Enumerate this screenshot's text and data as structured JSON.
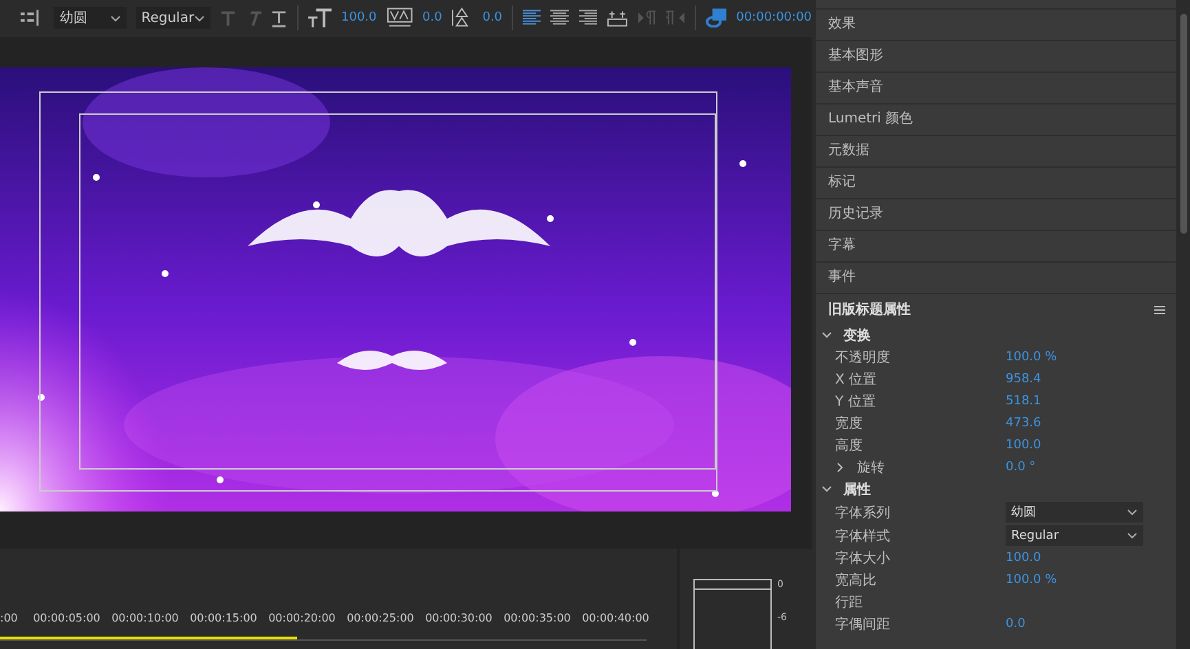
{
  "toolbar": {
    "font_family": "幼圆",
    "font_style": "Regular",
    "font_size": "100.0",
    "kerning": "0.0",
    "leading": "0.0",
    "alignment": [
      {
        "selected": true
      },
      {
        "selected": false
      },
      {
        "selected": false
      }
    ],
    "timecode": "00:00:00:00"
  },
  "panels": [
    "效果",
    "基本图形",
    "基本声音",
    "Lumetri 颜色",
    "元数据",
    "标记",
    "历史记录",
    "字幕",
    "事件"
  ],
  "properties": {
    "title": "旧版标题属性",
    "sections": [
      {
        "label": "变换",
        "expanded": true,
        "rows": [
          {
            "kind": "value",
            "label": "不透明度",
            "value": "100.0 %"
          },
          {
            "kind": "value",
            "label": "X 位置",
            "value": "958.4"
          },
          {
            "kind": "value",
            "label": "Y 位置",
            "value": "518.1"
          },
          {
            "kind": "value",
            "label": "宽度",
            "value": "473.6"
          },
          {
            "kind": "value",
            "label": "高度",
            "value": "100.0"
          },
          {
            "kind": "group",
            "label": "旋转",
            "expanded": false,
            "value": "0.0 °"
          }
        ]
      },
      {
        "label": "属性",
        "expanded": true,
        "rows": [
          {
            "kind": "dropdown",
            "label": "字体系列",
            "value": "幼圆"
          },
          {
            "kind": "dropdown",
            "label": "字体样式",
            "value": "Regular"
          },
          {
            "kind": "value",
            "label": "字体大小",
            "value": "100.0"
          },
          {
            "kind": "value",
            "label": "宽高比",
            "value": "100.0 %"
          },
          {
            "kind": "value",
            "label": "行距"
          },
          {
            "kind": "value",
            "label": "字偶间距",
            "value": "0.0"
          }
        ]
      }
    ]
  },
  "timeline": {
    "ticks": [
      ":00",
      "00:00:05:00",
      "00:00:10:00",
      "00:00:15:00",
      "00:00:20:00",
      "00:00:25:00",
      "00:00:30:00",
      "00:00:35:00",
      "00:00:40:00"
    ],
    "level": 0.46
  },
  "meter": {
    "scale": [
      "0",
      "-6"
    ]
  }
}
